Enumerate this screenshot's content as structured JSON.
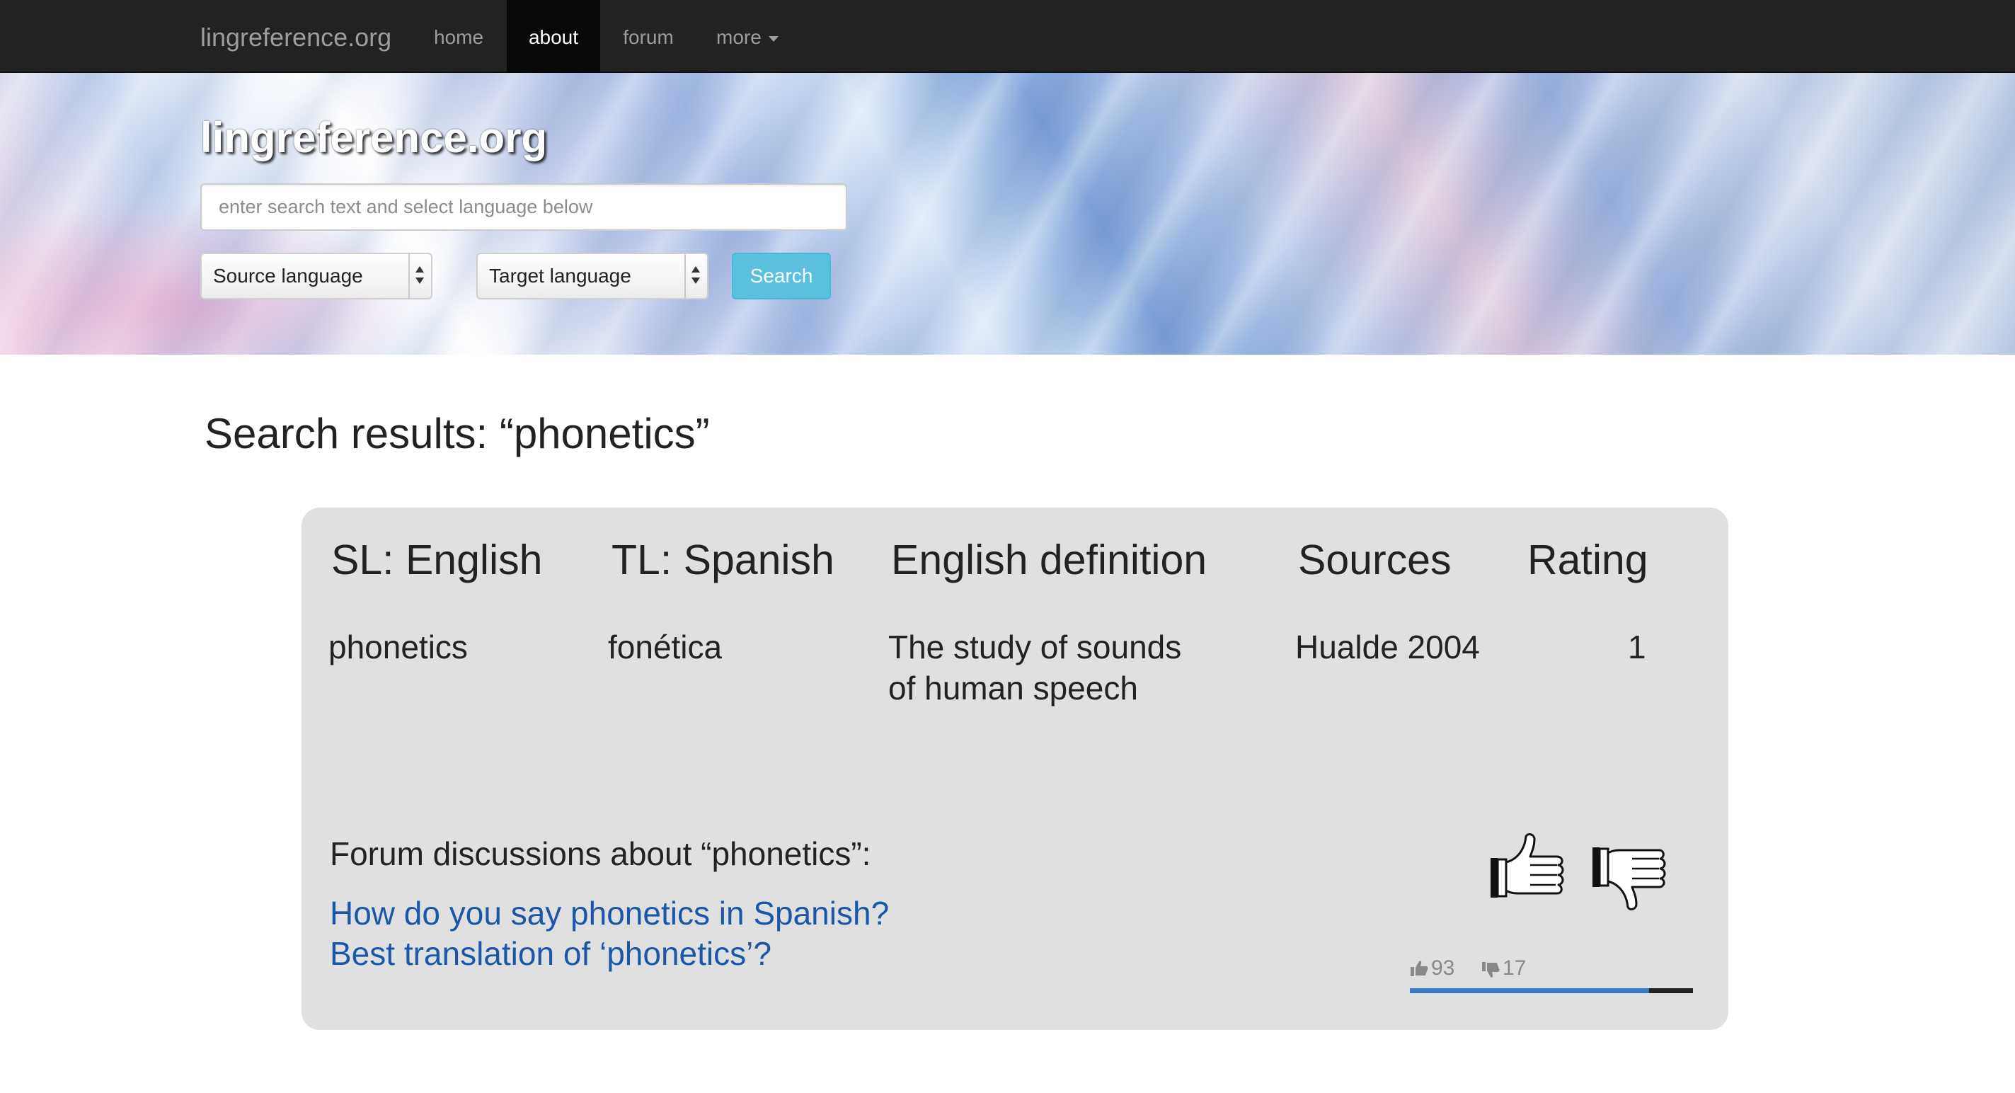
{
  "nav": {
    "brand": "lingreference.org",
    "items": [
      {
        "label": "home",
        "active": false
      },
      {
        "label": "about",
        "active": true
      },
      {
        "label": "forum",
        "active": false
      },
      {
        "label": "more",
        "active": false
      }
    ]
  },
  "hero": {
    "title": "lingreference.org",
    "search_placeholder": "enter search text and select language below",
    "source_select": "Source language",
    "target_select": "Target language",
    "search_button": "Search"
  },
  "results": {
    "title": "Search results:  “phonetics”",
    "headers": {
      "sl": "SL: English",
      "tl": "TL: Spanish",
      "definition": "English definition",
      "sources": "Sources",
      "rating": "Rating"
    },
    "row": {
      "sl": "phonetics",
      "tl": "fonética",
      "definition_line1": "The study of sounds",
      "definition_line2": "of human speech",
      "sources": "Hualde 2004",
      "rating": "1"
    },
    "forum": {
      "heading": "Forum discussions about “phonetics”:",
      "links": [
        "How do you say phonetics in Spanish?",
        "Best translation of ‘phonetics’?"
      ]
    },
    "votes": {
      "up": "93",
      "down": "17",
      "up_fraction": 0.845
    }
  },
  "colors": {
    "navbar": "#222222",
    "accent_button": "#5bc0de",
    "link": "#1a57a8",
    "card": "#e0e0e0",
    "vote_bar": "#3a78c2"
  },
  "icons": [
    "thumbs-up-icon",
    "thumbs-down-icon",
    "caret-down-icon"
  ]
}
